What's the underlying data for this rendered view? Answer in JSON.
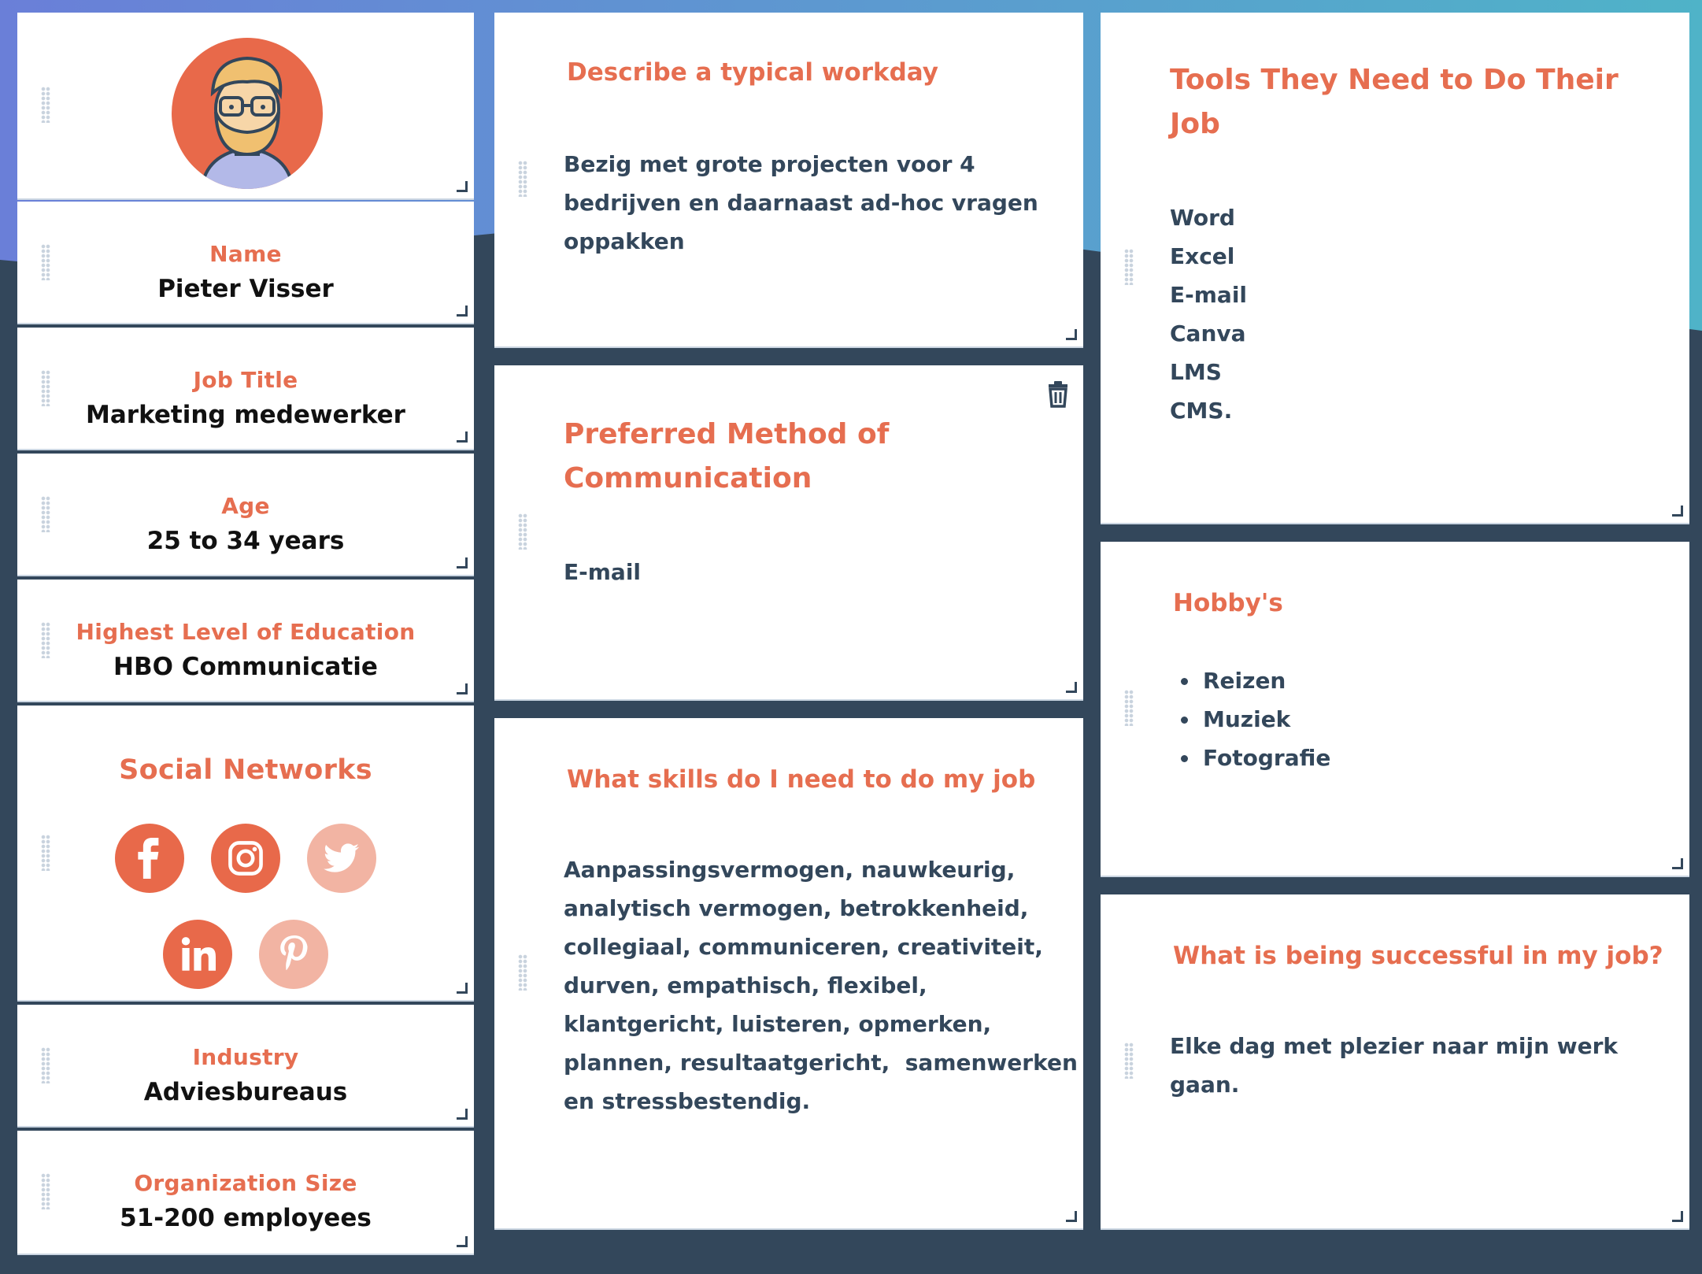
{
  "profile": {
    "avatar_alt": "persona avatar",
    "fields": [
      {
        "label": "Name",
        "value": "Pieter Visser"
      },
      {
        "label": "Job Title",
        "value": "Marketing medewerker"
      },
      {
        "label": "Age",
        "value": "25 to 34 years"
      },
      {
        "label": "Highest Level of Education",
        "value": "HBO Communicatie"
      },
      {
        "label": "Industry",
        "value": "Adviesbureaus"
      },
      {
        "label": "Organization Size",
        "value": "51-200 employees"
      }
    ],
    "social": {
      "title": "Social Networks",
      "networks": [
        {
          "name": "facebook",
          "active": true
        },
        {
          "name": "instagram",
          "active": true
        },
        {
          "name": "twitter",
          "active": false
        },
        {
          "name": "linkedin",
          "active": true
        },
        {
          "name": "pinterest",
          "active": false
        }
      ]
    }
  },
  "cards": {
    "workday": {
      "title": "Describe a typical workday",
      "lines": [
        "Bezig met grote projecten voor 4",
        "bedrijven en daarnaast ad-hoc vragen",
        "oppakken"
      ]
    },
    "communication": {
      "title_lines": [
        "Preferred Method of",
        "Communication"
      ],
      "body": "E-mail"
    },
    "skills": {
      "title": "What skills do I need to do my job",
      "lines": [
        "Aanpassingsvermogen, nauwkeurig,",
        "analytisch vermogen, betrokkenheid,",
        "collegiaal, communiceren, creativiteit,",
        "durven, empathisch, flexibel,",
        "klantgericht, luisteren, opmerken,",
        "plannen, resultaatgericht,  samenwerken",
        "en stressbestendig."
      ]
    },
    "tools": {
      "title_lines": [
        "Tools They Need to Do Their",
        "Job"
      ],
      "items": [
        "Word",
        "Excel",
        "E-mail",
        "Canva",
        "LMS",
        "CMS."
      ]
    },
    "hobbies": {
      "title": "Hobby's",
      "items": [
        "Reizen",
        "Muziek",
        "Fotografie"
      ]
    },
    "success": {
      "title": "What is being successful in my job?",
      "lines": [
        "Elke dag met plezier naar mijn werk",
        "gaan."
      ]
    }
  },
  "colors": {
    "accent": "#e66e50",
    "text": "#33475b",
    "background": "#33475b",
    "gradient_start": "#6a7fd8",
    "gradient_end": "#4fb3c8"
  },
  "icons": {
    "drag_handle": "drag-handle-icon",
    "resize_handle": "resize-handle-icon",
    "delete": "trash-icon"
  }
}
